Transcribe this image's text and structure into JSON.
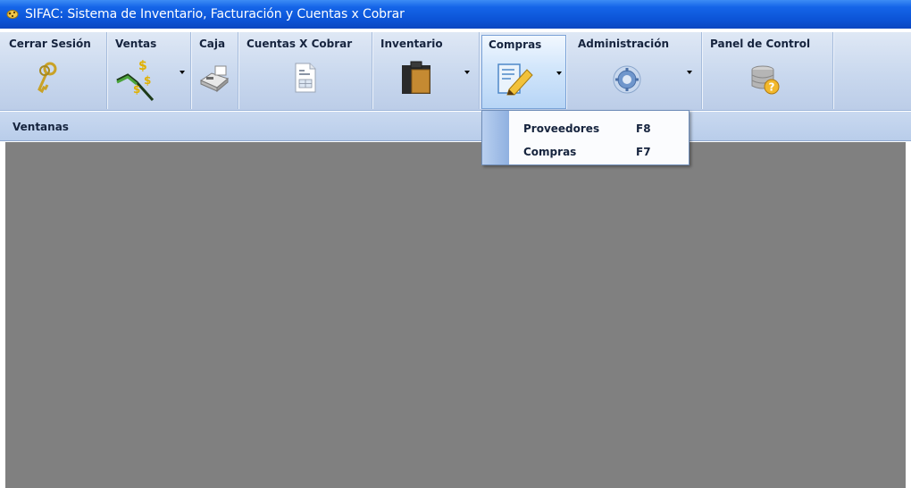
{
  "window": {
    "title": "SIFAC: Sistema de Inventario, Facturación y Cuentas x Cobrar",
    "icon": "app-logo-icon"
  },
  "toolbar": {
    "buttons": [
      {
        "label": "Cerrar Sesión",
        "icon": "keys-icon",
        "has_dropdown": false
      },
      {
        "label": "Ventas",
        "icon": "sales-chart-icon",
        "has_dropdown": true
      },
      {
        "label": "Caja",
        "icon": "cash-register-icon",
        "has_dropdown": false
      },
      {
        "label": "Cuentas X Cobrar",
        "icon": "document-icon",
        "has_dropdown": false
      },
      {
        "label": "Inventario",
        "icon": "clipboard-icon",
        "has_dropdown": true
      },
      {
        "label": "Compras",
        "icon": "edit-document-icon",
        "has_dropdown": true,
        "active": true
      },
      {
        "label": "Administración",
        "icon": "gear-icon",
        "has_dropdown": true
      },
      {
        "label": "Panel de Control",
        "icon": "database-help-icon",
        "has_dropdown": false
      }
    ]
  },
  "windows_bar": {
    "label": "Ventanas"
  },
  "compras_menu": {
    "items": [
      {
        "label": "Proveedores",
        "shortcut": "F8"
      },
      {
        "label": "Compras",
        "shortcut": "F7"
      }
    ]
  },
  "colors": {
    "titlebar": "#0b53d6",
    "toolbar_bg": "#c9d8ee",
    "workspace_bg": "#808080",
    "menu_gutter": "#8fb0e0"
  }
}
